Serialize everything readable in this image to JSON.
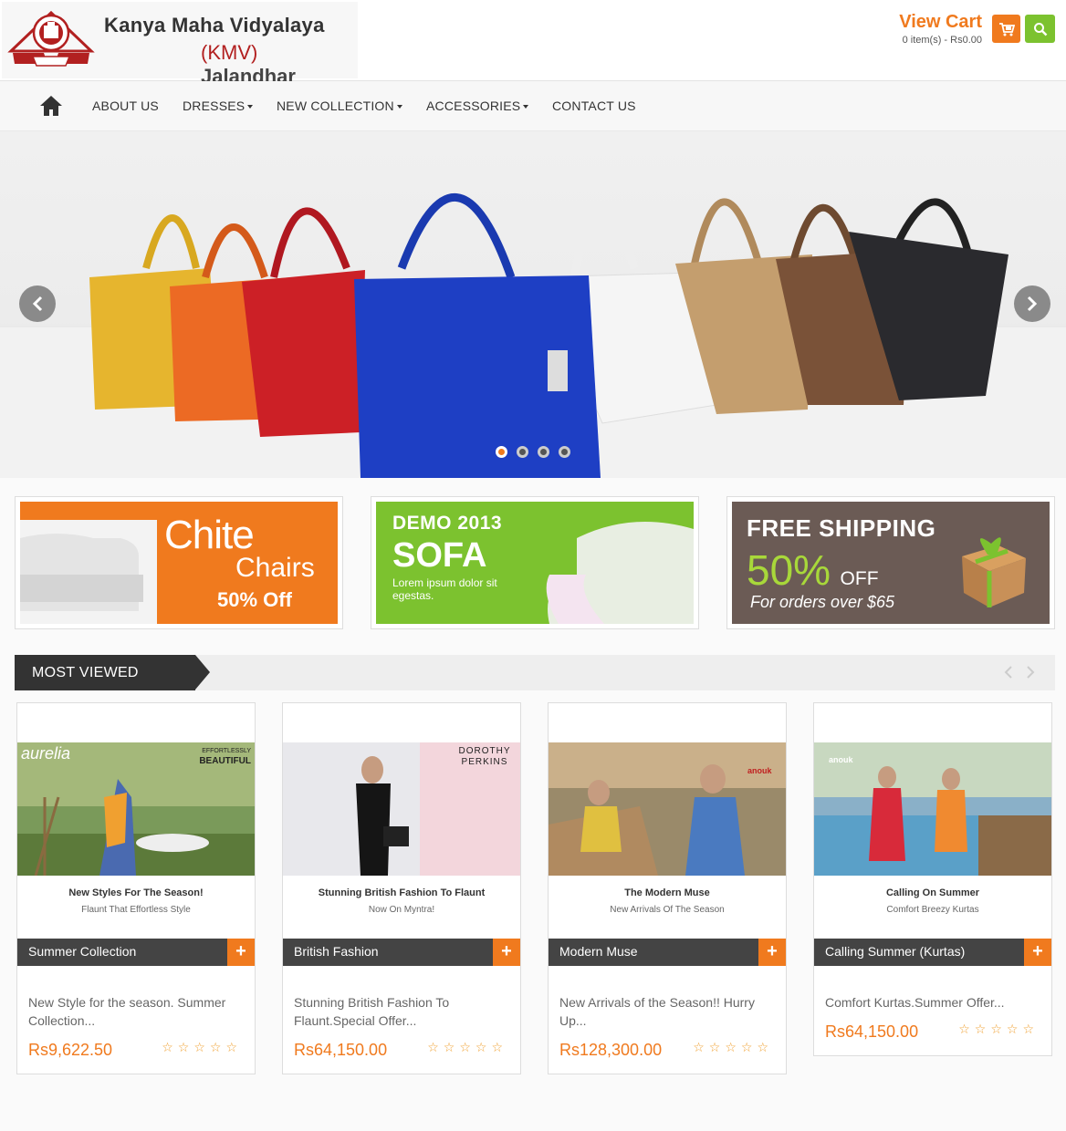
{
  "header": {
    "brand_line1": "Kanya Maha Vidyalaya",
    "brand_kmv": "(KMV)",
    "brand_city": " Jalandhar",
    "cart_title": "View Cart",
    "cart_summary": "0 item(s) - Rs0.00",
    "icons": [
      "cart-icon",
      "search-icon"
    ]
  },
  "nav": {
    "items": [
      {
        "label": "ABOUT US",
        "dropdown": false
      },
      {
        "label": "DRESSES",
        "dropdown": true
      },
      {
        "label": "NEW COLLECTION",
        "dropdown": true
      },
      {
        "label": "ACCESSORIES",
        "dropdown": true
      },
      {
        "label": "CONTACT US",
        "dropdown": false
      }
    ]
  },
  "slider": {
    "active_slide": 1,
    "slide_count": 4
  },
  "promos": [
    {
      "line1": "Chite",
      "line2": "Chairs",
      "line3": "50% Off"
    },
    {
      "line1": "DEMO 2013",
      "line2": "SOFA",
      "line3": "Lorem ipsum dolor sit egestas."
    },
    {
      "line1": "FREE SHIPPING",
      "line2": "50%",
      "line2b": "OFF",
      "line3": "For orders over $65"
    }
  ],
  "section": {
    "title": "MOST VIEWED"
  },
  "products": [
    {
      "brand": "aurelia",
      "brand_tag": "BEAUTIFUL",
      "brand_tag_small": "EFFORTLESSLY",
      "caption_title": "New Styles For The Season!",
      "caption_sub": "Flaunt That Effortless Style",
      "name": "Summer Collection",
      "desc": "New Style for the season. Summer Collection...",
      "price": "Rs9,622.50"
    },
    {
      "brand": "DOROTHY PERKINS",
      "caption_title": "Stunning British Fashion To Flaunt",
      "caption_sub": "Now On Myntra!",
      "name": "British Fashion",
      "desc": "Stunning British Fashion To Flaunt.Special Offer...",
      "price": "Rs64,150.00"
    },
    {
      "brand": "anouk",
      "caption_title": "The Modern Muse",
      "caption_sub": "New Arrivals Of The Season",
      "name": "Modern Muse",
      "desc": "New Arrivals of the Season!! Hurry Up...",
      "price": "Rs128,300.00"
    },
    {
      "brand": "anouk",
      "caption_title": "Calling On Summer",
      "caption_sub": "Comfort Breezy Kurtas",
      "name": "Calling Summer (Kurtas)",
      "desc": "Comfort Kurtas.Summer Offer...",
      "price": "Rs64,150.00"
    }
  ],
  "ratings": {
    "stars": "☆☆☆☆☆"
  },
  "colors": {
    "accent": "#f07a1e",
    "green": "#7cc22f",
    "dark": "#333333"
  }
}
